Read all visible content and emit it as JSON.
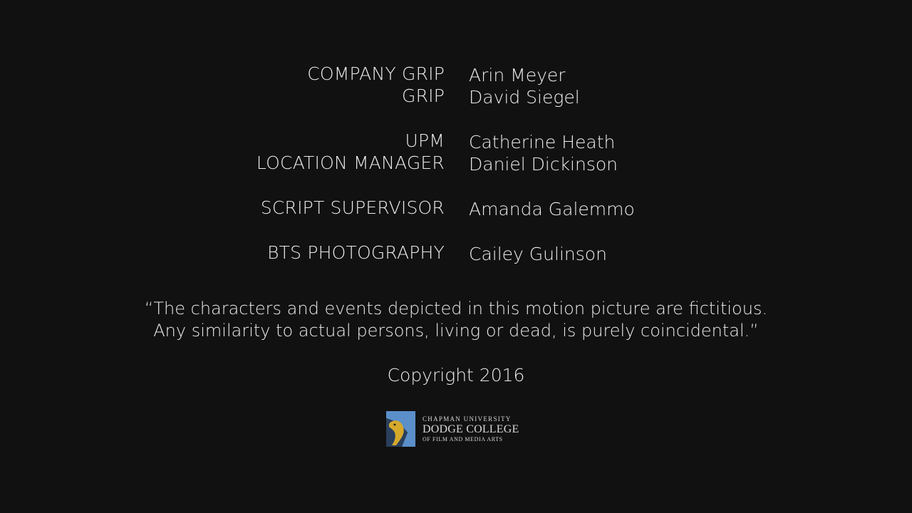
{
  "credits": [
    {
      "rows": [
        {
          "role": "COMPANY GRIP",
          "name": "Arin Meyer"
        },
        {
          "role": "GRIP",
          "name": "David Siegel"
        }
      ]
    },
    {
      "rows": [
        {
          "role": "UPM",
          "name": "Catherine Heath"
        },
        {
          "role": "LOCATION MANAGER",
          "name": "Daniel Dickinson"
        }
      ]
    },
    {
      "rows": [
        {
          "role": "SCRIPT SUPERVISOR",
          "name": "Amanda Galemmo"
        }
      ]
    },
    {
      "rows": [
        {
          "role": "BTS PHOTOGRAPHY",
          "name": "Cailey Gulinson"
        }
      ]
    }
  ],
  "disclaimer": {
    "line1": "“The characters and events depicted in this motion picture are fictitious.",
    "line2": "Any similarity to  actual persons, living or dead, is purely coincidental.”"
  },
  "copyright": "Copyright 2016",
  "logo": {
    "icon": "panther-crest-icon",
    "line1": "CHAPMAN UNIVERSITY",
    "line2": "DODGE COLLEGE",
    "line3": "OF FILM AND MEDIA ARTS"
  },
  "colors": {
    "background": "#111111",
    "text": "#ececec",
    "logo_blue": "#5b8fc9",
    "logo_gold": "#d4a92c"
  }
}
